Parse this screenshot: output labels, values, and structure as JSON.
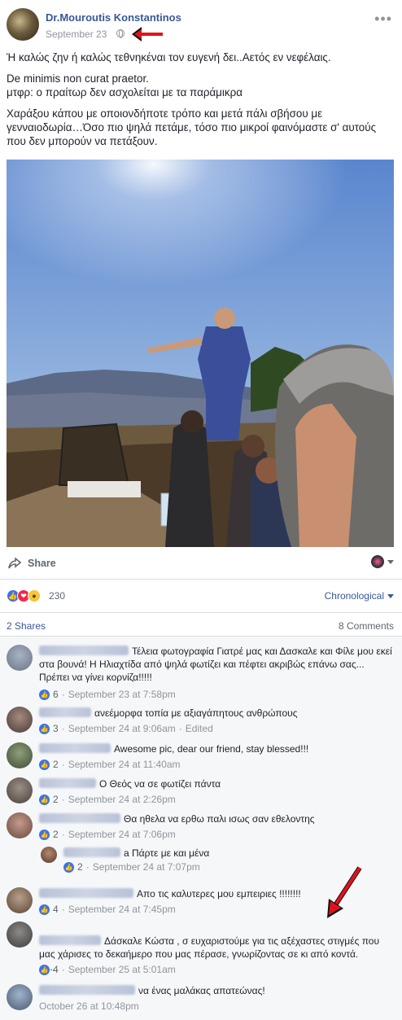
{
  "post": {
    "author": "Dr.Mouroutis Konstantinos",
    "date": "September 23",
    "paragraphs": [
      "Ή καλώς ζην ή καλώς τεθνηκέναι τον ευγενή δει..Αετός εν νεφέλαις.",
      "De minimis non curat praetor.\nμτφρ: ο πραίτωρ δεν ασχολείται με τα παράμικρα",
      "Χαράξου κάπου με οποιονδήποτε τρόπο και μετά πάλι σβήσου με γενναιοδωρία…Όσο πιο ψηλά πετάμε, τόσο πιο μικροί φαινόμαστε σ' αυτούς που δεν μπορούν να πετάξουν."
    ]
  },
  "actions": {
    "share_label": "Share"
  },
  "reactions": {
    "count": "230",
    "sort_label": "Chronological"
  },
  "stats": {
    "shares": "2 Shares",
    "comments": "8 Comments"
  },
  "comments": [
    {
      "text": "Τέλεια φωτογραφία Γιατρέ μας και Δασκαλε και Φίλε μου εκεί στα βουνά! Η Ηλιαχτίδα από ψηλά φωτίζει και πέφτει ακριβώς επάνω σας... Πρέπει να γίνει κορνίζα!!!!!",
      "likes": "6",
      "time": "September 23 at 7:58pm",
      "extra": ""
    },
    {
      "text": "ανεέμορφα τοπία με αξιαγάπητους ανθρώπους",
      "likes": "3",
      "time": "September 24 at 9:06am",
      "extra": "Edited"
    },
    {
      "text": "Awesome pic, dear our friend, stay blessed!!!",
      "likes": "2",
      "time": "September 24 at 11:40am",
      "extra": ""
    },
    {
      "text": "Ο Θεός να σε φωτίζει πάντα",
      "likes": "2",
      "time": "September 24 at 2:26pm",
      "extra": ""
    },
    {
      "text": "Θα ηθελα να ερθω παλι ισως σαν εθελοντης",
      "likes": "2",
      "time": "September 24 at 7:06pm",
      "extra": ""
    },
    {
      "text": "a Πάρτε με και μένα",
      "likes": "2",
      "time": "September 24 at 7:07pm",
      "extra": ""
    },
    {
      "text": "Απο τις καλυτερες μου εμπειριες !!!!!!!!",
      "likes": "4",
      "time": "September 24 at 7:45pm",
      "extra": ""
    },
    {
      "text": "Δάσκαλε Κώστα , σ ευχαριστούμε για τις αξέχαστες στιγμές που μας χάρισες το δεκαήμερο που μας πέρασε, γνωρίζοντας σε κι από κοντά.\n.......",
      "likes": "4",
      "time": "September 25 at 5:01am",
      "extra": ""
    },
    {
      "text": "να ένας μαλάκας απατεώνας!",
      "likes": "",
      "time": "October 26 at 10:48pm",
      "extra": ""
    }
  ],
  "colors": {
    "link": "#385898",
    "meta": "#90949c",
    "like": "#3b73e5",
    "annotation_arrow": "#e0131a"
  }
}
